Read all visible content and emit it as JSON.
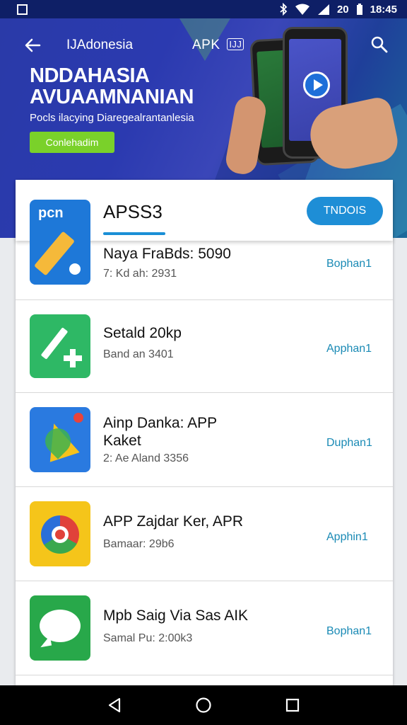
{
  "status_bar": {
    "time": "18:45",
    "battery_text": "20"
  },
  "banner": {
    "country": "IJAdonesia",
    "apk_label": "APK",
    "apk_badge": "IJJ",
    "title_line1": "NDDAHASIA",
    "title_line2": "AVUAAMNANIAN",
    "subtitle": "Pocls ilacying Diaregealrantanlesia",
    "cta": "Conlehadim",
    "colors": {
      "cta": "#7ad12a"
    }
  },
  "card": {
    "header": {
      "title": "APSS3",
      "button": "TNDOIS"
    },
    "apps": [
      {
        "name": "Naya FraBds: 5090",
        "meta": "7: Kd ah: 2931",
        "action": "Bophan1",
        "icon": "pencil-app-icon"
      },
      {
        "name": "Setald 20kp",
        "meta": "Band an 3401",
        "action": "Apphan1",
        "icon": "sideload-app-icon"
      },
      {
        "name": "Ainp Danka: APP Kaket",
        "meta": "2: Ae Aland 3356",
        "action": "Duphan1",
        "icon": "maps-app-icon"
      },
      {
        "name": "APP Zajdar Ker, APR",
        "meta": "Bamaar: 29b6",
        "action": "Apphin1",
        "icon": "chrome-app-icon"
      },
      {
        "name": "Mpb Saig Via Sas AIK",
        "meta": "Samal Pu: 2:00k3",
        "action": "Bophan1",
        "icon": "chat-app-icon"
      }
    ]
  },
  "nav_bar": {
    "items": [
      "back-icon",
      "home-icon",
      "recents-icon"
    ]
  }
}
